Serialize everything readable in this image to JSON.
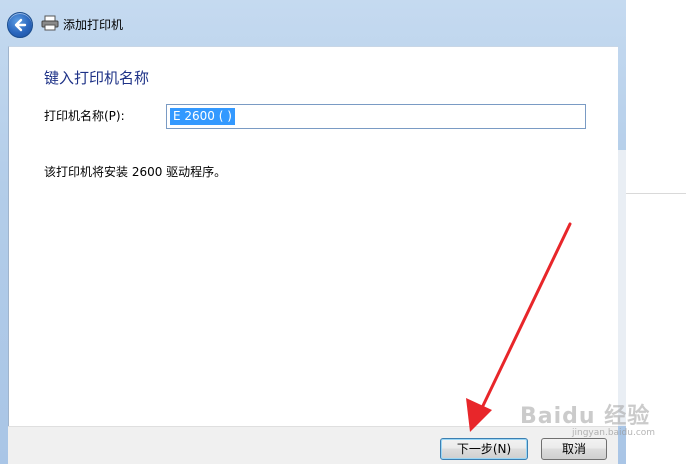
{
  "window": {
    "title": "添加打印机",
    "back_icon": "back-arrow-icon",
    "title_icon": "printer-icon"
  },
  "main": {
    "heading": "键入打印机名称",
    "name_label": "打印机名称(P):",
    "name_value": "E        2600 (       )",
    "driver_text": "该打印机将安装              2600 驱动程序。"
  },
  "footer": {
    "next_label": "下一步(N)",
    "cancel_label": "取消"
  },
  "overlay": {
    "watermark": "Baidu 经验",
    "watermark_sub": "jingyan.baidu.com",
    "arrow_color": "#e8262a"
  },
  "colors": {
    "heading": "#1e3287",
    "selection": "#3399ff",
    "frame": "#b3cde9"
  }
}
